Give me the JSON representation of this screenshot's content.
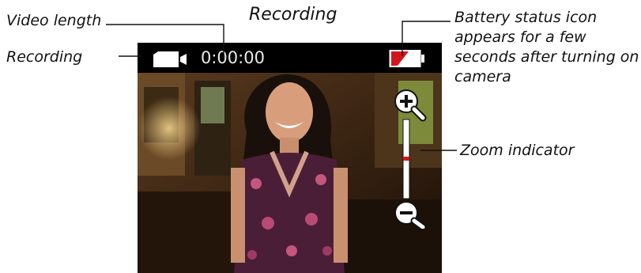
{
  "title": "Recording",
  "labels": {
    "video_length": "Video length",
    "recording": "Recording",
    "battery": [
      "Battery status icon",
      "appears for a few",
      "seconds after turning on",
      "camera"
    ],
    "zoom": "Zoom indicator"
  },
  "screen": {
    "timer": "0:00:00",
    "icons": [
      "video-camera-icon",
      "battery-low-icon",
      "zoom-in-icon",
      "zoom-out-icon"
    ],
    "colors": {
      "battery_fill": "#d4161c",
      "zoom_marker": "#d4161c"
    }
  }
}
